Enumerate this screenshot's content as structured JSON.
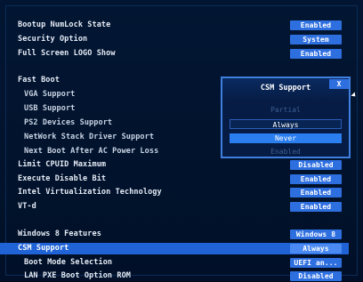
{
  "settings": {
    "bootup_numlock": {
      "label": "Bootup NumLock State",
      "value": "Enabled"
    },
    "security_option": {
      "label": "Security Option",
      "value": "System"
    },
    "full_screen_logo": {
      "label": "Full Screen LOGO Show",
      "value": "Enabled"
    },
    "fast_boot": {
      "label": "Fast Boot"
    },
    "vga_support": {
      "label": "VGA Support"
    },
    "usb_support": {
      "label": "USB Support"
    },
    "ps2_support": {
      "label": "PS2 Devices Support"
    },
    "network_stack": {
      "label": "NetWork Stack Driver Support"
    },
    "next_boot_ac": {
      "label": "Next Boot After AC Power Loss"
    },
    "limit_cpuid": {
      "label": "Limit CPUID Maximum",
      "value": "Disabled"
    },
    "execute_disable": {
      "label": "Execute Disable Bit",
      "value": "Enabled"
    },
    "intel_vt": {
      "label": "Intel Virtualization Technology",
      "value": "Enabled"
    },
    "vt_d": {
      "label": "VT-d",
      "value": "Enabled"
    },
    "windows8_features": {
      "label": "Windows 8 Features",
      "value": "Windows 8"
    },
    "csm_support": {
      "label": "CSM Support",
      "value": "Always"
    },
    "boot_mode": {
      "label": "Boot Mode Selection",
      "value": "UEFI an..."
    },
    "lan_pxe": {
      "label": "LAN PXE Boot Option ROM",
      "value": "Disabled"
    }
  },
  "popup": {
    "title": "CSM Support",
    "close_label": "X",
    "ghost_top": "Partial",
    "options": [
      "Always",
      "Never"
    ],
    "ghost_bottom": "Enabled",
    "selected": "Never"
  },
  "colors": {
    "background": "#021633",
    "value_button": "#2e6fe0",
    "selected_row": "#1f63d6",
    "popup_selected": "#2a7ef0"
  }
}
